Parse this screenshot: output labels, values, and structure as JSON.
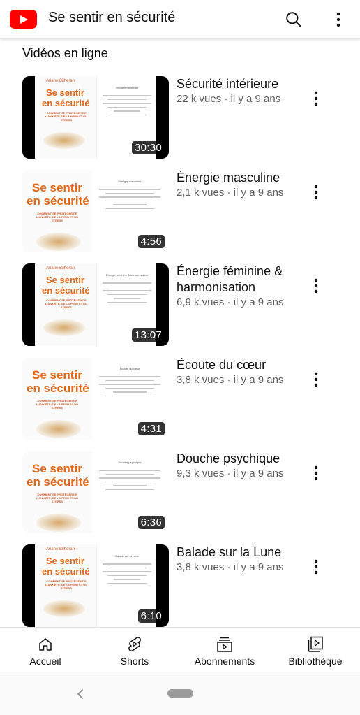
{
  "header": {
    "title": "Se sentir en sécurité",
    "logo_icon": "youtube-logo-icon",
    "search_icon": "search-icon",
    "more_icon": "more-vert-icon",
    "brand_color": "#ff0000"
  },
  "section": {
    "title": "Vidéos en ligne"
  },
  "book": {
    "author": "Ariane Bilheran",
    "title_line1": "Se sentir",
    "title_line2": "en sécurité",
    "subtitle": "COMMENT SE PROTÉGER DE L'ANXIÉTÉ, DE LA PEUR ET DU STRESS"
  },
  "videos": [
    {
      "title": "Sécurité intérieure",
      "meta": "22 k vues · il y a 9 ans",
      "duration": "30:30",
      "page_heading": "Sécurité intérieure"
    },
    {
      "title": "Énergie masculine",
      "meta": "2,1 k vues · il y a 9 ans",
      "duration": "4:56",
      "page_heading": "Énergie masculine"
    },
    {
      "title": "Énergie féminine & harmonisation",
      "meta": "6,9 k vues · il y a 9 ans",
      "duration": "13:07",
      "page_heading": "Énergie féminine & harmonisation"
    },
    {
      "title": "Écoute du cœur",
      "meta": "3,8 k vues · il y a 9 ans",
      "duration": "4:31",
      "page_heading": "Écoute du cœur"
    },
    {
      "title": "Douche psychique",
      "meta": "9,3 k vues · il y a 9 ans",
      "duration": "6:36",
      "page_heading": "Douche psychique"
    },
    {
      "title": "Balade sur la Lune",
      "meta": "3,8 k vues · il y a 9 ans",
      "duration": "6:10",
      "page_heading": "Balade sur la Lune"
    }
  ],
  "bottom_nav": [
    {
      "label": "Accueil",
      "icon": "home-icon"
    },
    {
      "label": "Shorts",
      "icon": "shorts-icon"
    },
    {
      "label": "Abonnements",
      "icon": "subscriptions-icon"
    },
    {
      "label": "Bibliothèque",
      "icon": "library-icon"
    }
  ],
  "system_nav": {
    "back_icon": "back-chevron-icon",
    "home_icon": "home-pill-icon"
  }
}
